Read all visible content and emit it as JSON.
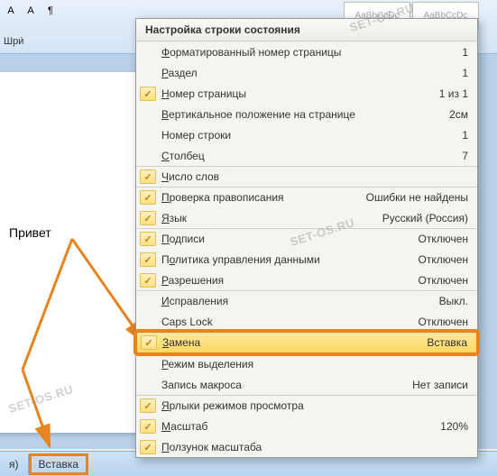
{
  "font_group_label": "Шри́",
  "doc_text": "Привет",
  "style_samples": [
    "AaBbCcDc",
    "AaBbCcDc"
  ],
  "status_tabs": {
    "left": "я)",
    "insert": "Вставка"
  },
  "menu": {
    "title": "Настройка строки состояния",
    "items": [
      {
        "checked": false,
        "label": "Форматированный номер страницы",
        "value": "1",
        "sep": false,
        "u": 0
      },
      {
        "checked": false,
        "label": "Раздел",
        "value": "1",
        "sep": false,
        "u": 0
      },
      {
        "checked": true,
        "label": "Номер страницы",
        "value": "1 из 1",
        "sep": false,
        "u": 0
      },
      {
        "checked": false,
        "label": "Вертикальное положение на странице",
        "value": "2см",
        "sep": false,
        "u": 0
      },
      {
        "checked": false,
        "label": "Номер строки",
        "value": "1",
        "sep": false,
        "u": -1
      },
      {
        "checked": false,
        "label": "Столбец",
        "value": "7",
        "sep": false,
        "u": 0
      },
      {
        "checked": true,
        "label": "Число слов",
        "value": "",
        "sep": true,
        "u": 0
      },
      {
        "checked": true,
        "label": "Проверка правописания",
        "value": "Ошибки не найдены",
        "sep": true,
        "u": 0
      },
      {
        "checked": true,
        "label": "Язык",
        "value": "Русский (Россия)",
        "sep": false,
        "u": 0
      },
      {
        "checked": true,
        "label": "Подписи",
        "value": "Отключен",
        "sep": true,
        "u": 0
      },
      {
        "checked": true,
        "label": "Политика управления данными",
        "value": "Отключен",
        "sep": false,
        "u": 1
      },
      {
        "checked": true,
        "label": "Разрешения",
        "value": "Отключен",
        "sep": false,
        "u": 0
      },
      {
        "checked": false,
        "label": "Исправления",
        "value": "Выкл.",
        "sep": true,
        "u": 0
      },
      {
        "checked": false,
        "label": "Caps Lock",
        "value": "Отключен",
        "sep": false,
        "u": -1
      },
      {
        "checked": true,
        "label": "Замена",
        "value": "Вставка",
        "sep": false,
        "u": 0,
        "highlight": true,
        "boxed": true
      },
      {
        "checked": false,
        "label": "Режим выделения",
        "value": "",
        "sep": false,
        "u": 0
      },
      {
        "checked": false,
        "label": "Запись макроса",
        "value": "Нет записи",
        "sep": false,
        "u": -1
      },
      {
        "checked": true,
        "label": "Ярлыки режимов просмотра",
        "value": "",
        "sep": true,
        "u": 0
      },
      {
        "checked": true,
        "label": "Масштаб",
        "value": "120%",
        "sep": false,
        "u": 0
      },
      {
        "checked": true,
        "label": "Ползунок масштаба",
        "value": "",
        "sep": false,
        "u": 0
      }
    ]
  },
  "watermark": "SET-OS.RU"
}
